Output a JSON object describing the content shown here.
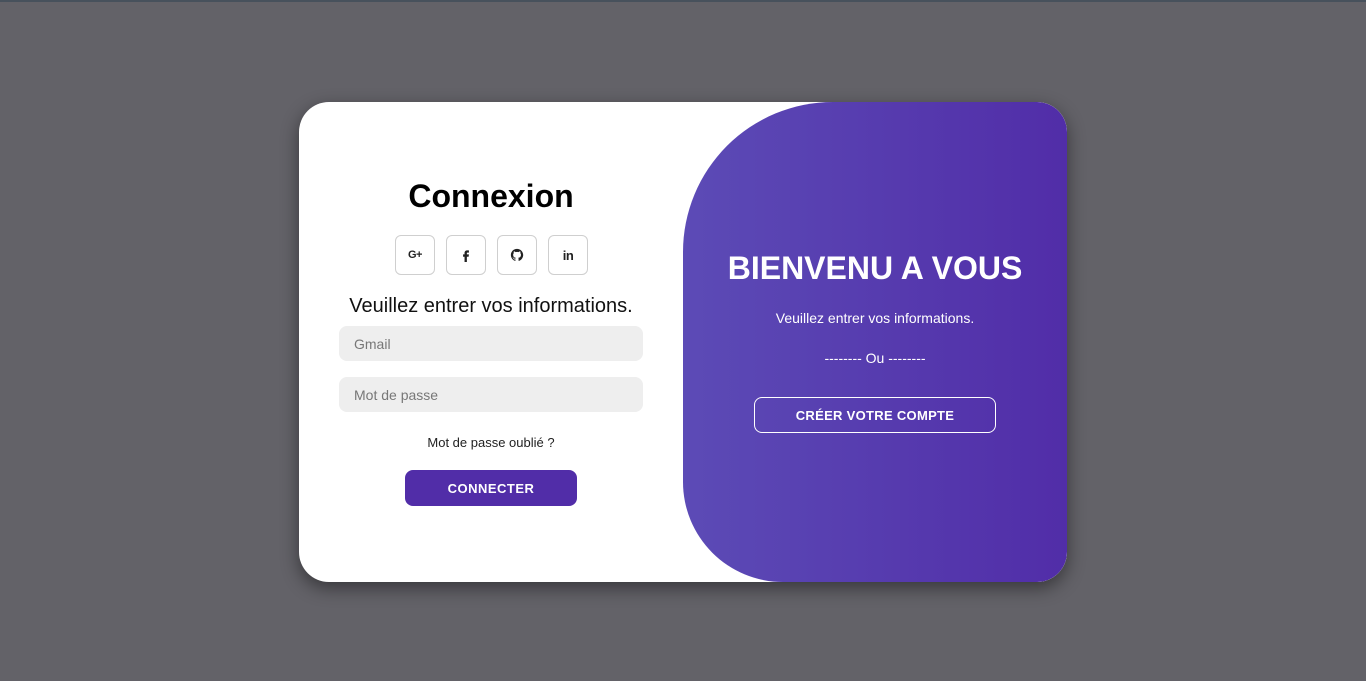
{
  "login": {
    "title": "Connexion",
    "social_buttons": [
      {
        "icon": "google-plus-icon",
        "label": "G+"
      },
      {
        "icon": "facebook-icon"
      },
      {
        "icon": "github-icon"
      },
      {
        "icon": "linkedin-icon",
        "label": "in"
      }
    ],
    "subtitle": "Veuillez entrer vos informations.",
    "email": {
      "placeholder": "Gmail",
      "value": ""
    },
    "password": {
      "placeholder": "Mot de passe",
      "value": ""
    },
    "forgot_label": "Mot de passe oublié ?",
    "submit_label": "CONNECTER"
  },
  "welcome": {
    "title": "BIENVENU A VOUS",
    "text": "Veuillez entrer vos informations.",
    "separator": "-------- Ou --------",
    "create_label": "CRÉER VOTRE COMPTE"
  },
  "colors": {
    "background": "#636268",
    "accent": "#512da8",
    "gradient_start": "#5c4bb6",
    "gradient_end": "#512da8",
    "input_bg": "#eeeeee"
  }
}
